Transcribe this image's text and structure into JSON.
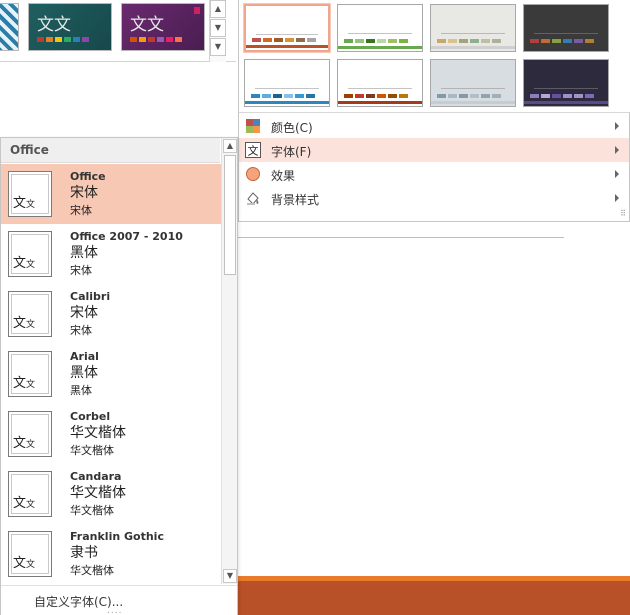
{
  "gallery": {
    "thumb_text": "文文",
    "thumbs": [
      {
        "bar_colors": [
          "#c0392b",
          "#e67e22",
          "#f1c40f",
          "#27ae60",
          "#2980b9",
          "#8e44ad"
        ]
      },
      {
        "bar_colors": [
          "#d35400",
          "#f39c12",
          "#c0392b",
          "#9b59b6",
          "#e91e63",
          "#ff7043"
        ]
      }
    ]
  },
  "variants": [
    {
      "name": "variant-office-orange",
      "bar_colors": [
        "#c0504d",
        "#d06a2b",
        "#9e5a2a",
        "#d8923a",
        "#8c6c4a",
        "#a6a6a6"
      ],
      "line_color": "#b85028",
      "bg": "#ffffff",
      "selected": true
    },
    {
      "name": "variant-green",
      "bar_colors": [
        "#6aa84f",
        "#93c47d",
        "#38761d",
        "#b6d7a8",
        "#a0c060",
        "#7cb342"
      ],
      "line_color": "#6aa84f",
      "bg": "#ffffff",
      "selected": false
    },
    {
      "name": "variant-gray",
      "bar_colors": [
        "#c8a86a",
        "#d9c38a",
        "#a3a37a",
        "#8faf8f",
        "#c0c0a0",
        "#b0b09a"
      ],
      "line_color": "#cfcfcf",
      "bg": "#e8e8e4",
      "selected": false
    },
    {
      "name": "variant-dark",
      "bar_colors": [
        "#b04040",
        "#c06a3a",
        "#8aa040",
        "#3a7ab0",
        "#7a5aa0",
        "#b08030"
      ],
      "line_color": "#3a3a3a",
      "bg": "#3a3a3a",
      "selected": false
    },
    {
      "name": "variant-blue",
      "bar_colors": [
        "#2e86c1",
        "#5dade2",
        "#1f618d",
        "#85c1e9",
        "#3498db",
        "#2874a6"
      ],
      "line_color": "#2e86c1",
      "bg": "#ffffff",
      "selected": false
    },
    {
      "name": "variant-brown",
      "bar_colors": [
        "#a04000",
        "#c0392b",
        "#7e3a1f",
        "#d35400",
        "#964b00",
        "#b9770e"
      ],
      "line_color": "#a33a1a",
      "bg": "#ffffff",
      "selected": false
    },
    {
      "name": "variant-slate",
      "bar_colors": [
        "#7f9aaa",
        "#a8b8c4",
        "#8899a6",
        "#b0bec5",
        "#90a4ae",
        "#9fb0bb"
      ],
      "line_color": "#c5cdd4",
      "bg": "#d8dde2",
      "selected": false
    },
    {
      "name": "variant-purple",
      "bar_colors": [
        "#8e7cc3",
        "#b4a7d6",
        "#674ea7",
        "#9f8fd0",
        "#a392c9",
        "#7c6bb8"
      ],
      "line_color": "#5a4a8a",
      "bg": "#2e2a3e",
      "selected": false
    }
  ],
  "menu": {
    "items": [
      {
        "label": "颜色(C)",
        "icon": "palette-icon"
      },
      {
        "label": "字体(F)",
        "icon": "font-icon",
        "active": true
      },
      {
        "label": "效果",
        "icon": "effects-icon"
      },
      {
        "label": "背景样式",
        "icon": "background-style-icon"
      }
    ],
    "grip": "⠿"
  },
  "fonts_menu": {
    "header": "Office",
    "preview_text_big": "文",
    "preview_text_small": "文",
    "items": [
      {
        "name": "Office",
        "heading": "宋体",
        "body": "宋体",
        "selected": true
      },
      {
        "name": "Office 2007 - 2010",
        "heading": "黑体",
        "body": "宋体"
      },
      {
        "name": "Calibri",
        "heading": "宋体",
        "body": "宋体"
      },
      {
        "name": "Arial",
        "heading": "黑体",
        "body": "黑体"
      },
      {
        "name": "Corbel",
        "heading": "华文楷体",
        "body": "华文楷体"
      },
      {
        "name": "Candara",
        "heading": "华文楷体",
        "body": "华文楷体"
      },
      {
        "name": "Franklin Gothic",
        "heading": "隶书",
        "body": "华文楷体"
      }
    ],
    "custom_fonts_label": "自定义字体(C)...",
    "resize_grip": "....",
    "scroll_up": "▲",
    "scroll_down": "▼"
  },
  "gallery_scroll": {
    "up": "▲",
    "down": "▼",
    "more": "▼"
  }
}
